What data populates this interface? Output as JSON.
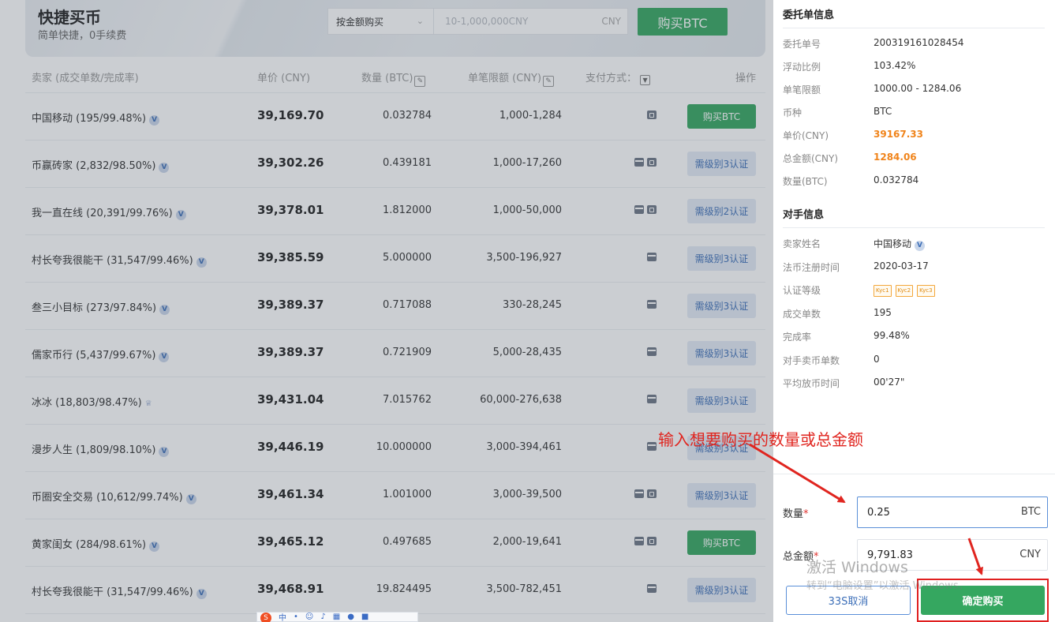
{
  "hero": {
    "title": "快捷买币",
    "subtitle": "简单快捷，0手续费",
    "mode_select": "按金额购买",
    "amount_placeholder": "10-1,000,000CNY",
    "amount_unit": "CNY",
    "buy_button": "购买BTC"
  },
  "table": {
    "headers": {
      "seller": "卖家 (成交单数/完成率)",
      "price": "单价 (CNY)",
      "qty": "数量 (BTC)",
      "limit": "单笔限额 (CNY)",
      "pay": "支付方式：",
      "action": "操作"
    },
    "rows": [
      {
        "seller": "中国移动 (195/99.48%)",
        "badge": "V",
        "price": "39,169.70",
        "qty": "0.032784",
        "limit": "1,000-1,284",
        "pay": [
          "alipay"
        ],
        "action": "购买BTC"
      },
      {
        "seller": "币赢砖家 (2,832/98.50%)",
        "badge": "V",
        "price": "39,302.26",
        "qty": "0.439181",
        "limit": "1,000-17,260",
        "pay": [
          "card",
          "alipay"
        ],
        "action": "需级别3认证"
      },
      {
        "seller": "我一直在线 (20,391/99.76%)",
        "badge": "V",
        "price": "39,378.01",
        "qty": "1.812000",
        "limit": "1,000-50,000",
        "pay": [
          "card",
          "alipay"
        ],
        "action": "需级别2认证"
      },
      {
        "seller": "村长夸我很能干 (31,547/99.46%)",
        "badge": "V",
        "price": "39,385.59",
        "qty": "5.000000",
        "limit": "3,500-196,927",
        "pay": [
          "card"
        ],
        "action": "需级别3认证"
      },
      {
        "seller": "叁三小目标 (273/97.84%)",
        "badge": "V",
        "price": "39,389.37",
        "qty": "0.717088",
        "limit": "330-28,245",
        "pay": [
          "card"
        ],
        "action": "需级别3认证"
      },
      {
        "seller": "儒家币行 (5,437/99.67%)",
        "badge": "V",
        "price": "39,389.37",
        "qty": "0.721909",
        "limit": "5,000-28,435",
        "pay": [
          "card"
        ],
        "action": "需级别3认证"
      },
      {
        "seller": "冰冰 (18,803/98.47%)",
        "badge": "crown",
        "price": "39,431.04",
        "qty": "7.015762",
        "limit": "60,000-276,638",
        "pay": [
          "card"
        ],
        "action": "需级别3认证"
      },
      {
        "seller": "漫步人生 (1,809/98.10%)",
        "badge": "V",
        "price": "39,446.19",
        "qty": "10.000000",
        "limit": "3,000-394,461",
        "pay": [
          "card"
        ],
        "action": "需级别3认证"
      },
      {
        "seller": "币圈安全交易 (10,612/99.74%)",
        "badge": "V",
        "price": "39,461.34",
        "qty": "1.001000",
        "limit": "3,000-39,500",
        "pay": [
          "card",
          "alipay"
        ],
        "action": "需级别3认证"
      },
      {
        "seller": "黄家闺女 (284/98.61%)",
        "badge": "V",
        "price": "39,465.12",
        "qty": "0.497685",
        "limit": "2,000-19,641",
        "pay": [
          "card",
          "alipay"
        ],
        "action": "购买BTC"
      },
      {
        "seller": "村长夸我很能干 (31,547/99.46%)",
        "badge": "V",
        "price": "39,468.91",
        "qty": "19.824495",
        "limit": "3,500-782,451",
        "pay": [
          "card"
        ],
        "action": "需级别3认证"
      }
    ]
  },
  "panel": {
    "order_title": "委托单信息",
    "order": [
      {
        "k": "委托单号",
        "v": "200319161028454",
        "style": ""
      },
      {
        "k": "浮动比例",
        "v": "103.42%",
        "style": ""
      },
      {
        "k": "单笔限额",
        "v": "1000.00 - 1284.06",
        "style": ""
      },
      {
        "k": "币种",
        "v": "BTC",
        "style": ""
      },
      {
        "k": "单价(CNY)",
        "v": "39167.33",
        "style": "orange"
      },
      {
        "k": "总金额(CNY)",
        "v": "1284.06",
        "style": "orange"
      },
      {
        "k": "数量(BTC)",
        "v": "0.032784",
        "style": ""
      }
    ],
    "counterparty_title": "对手信息",
    "counterparty": [
      {
        "k": "卖家姓名",
        "v": "中国移动"
      },
      {
        "k": "法币注册时间",
        "v": "2020-03-17"
      },
      {
        "k": "认证等级",
        "v": ""
      },
      {
        "k": "成交单数",
        "v": "195"
      },
      {
        "k": "完成率",
        "v": "99.48%"
      },
      {
        "k": "对手卖币单数",
        "v": "0"
      },
      {
        "k": "平均放币时间",
        "v": "00'27\""
      }
    ],
    "kyc_levels": [
      "Kyc1",
      "Kyc2",
      "Kyc3"
    ],
    "qty_label": "数量",
    "qty_value": "0.25",
    "qty_unit": "BTC",
    "total_label": "总金额",
    "total_value": "9,791.83",
    "total_unit": "CNY",
    "required_mark": "*",
    "cancel_button": "33S取消",
    "confirm_button": "确定购买"
  },
  "annotation": "输入想要购买的数量或总金额",
  "watermark": {
    "line1": "激活 Windows",
    "line2": "转到“电脑设置”以激活 Windows。"
  },
  "ime_bar": {
    "logo": "S",
    "lang": "中"
  },
  "colors": {
    "buy_green": "#35a760",
    "need_blue": "#3d6fb8",
    "price_orange": "#f0841b",
    "annotation_red": "#e0251f"
  }
}
